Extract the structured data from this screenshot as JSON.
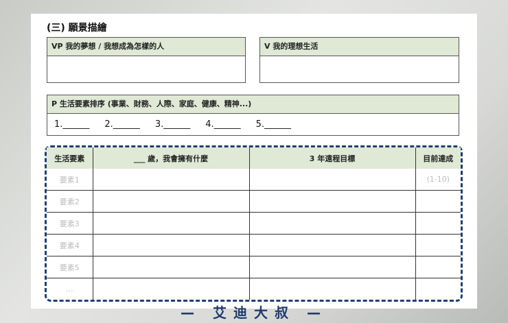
{
  "section_title": "(三) 願景描繪",
  "vp": {
    "header": "VP 我的夢想 / 我想成為怎樣的人"
  },
  "v": {
    "header": "V 我的理想生活"
  },
  "p": {
    "header": "P 生活要素排序 (事業、財務、人際、家庭、健康、精神...)",
    "slots": [
      "1.______",
      "2.______",
      "3.______",
      "4.______",
      "5.______"
    ]
  },
  "table": {
    "headers": [
      "生活要素",
      "___ 歲，我會擁有什麼",
      "3 年遠程目標",
      "目前達成"
    ],
    "rows": [
      [
        "要素1",
        "",
        "",
        "(1-10)"
      ],
      [
        "要素2",
        "",
        "",
        ""
      ],
      [
        "要素3",
        "",
        "",
        ""
      ],
      [
        "要素4",
        "",
        "",
        ""
      ],
      [
        "要素5",
        "",
        "",
        ""
      ],
      [
        "...",
        "",
        "",
        ""
      ]
    ]
  },
  "footer": "— 艾迪大叔 —"
}
